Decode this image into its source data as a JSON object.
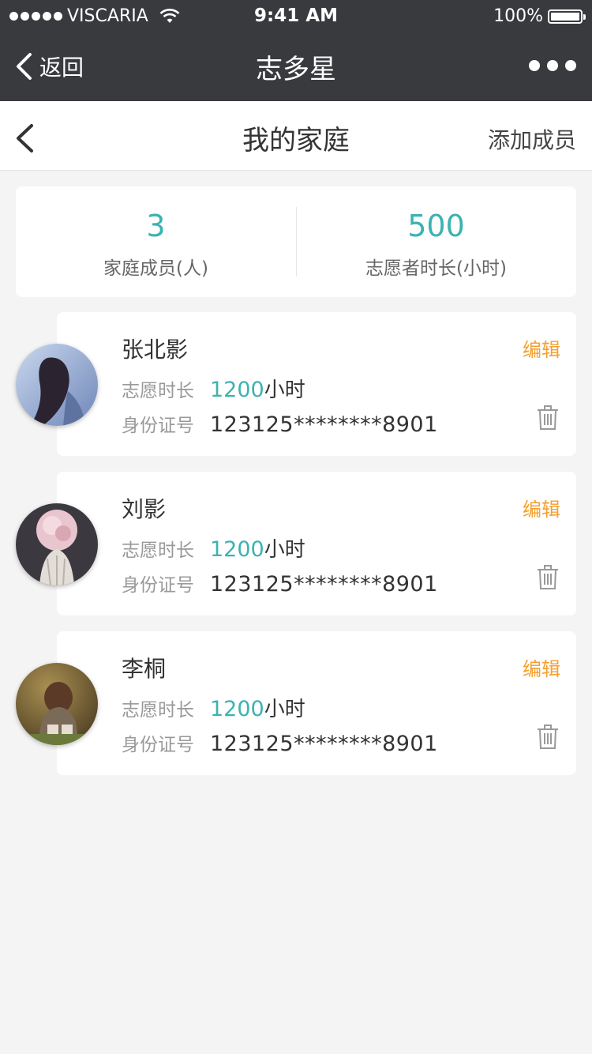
{
  "status_bar": {
    "carrier": "VISCARIA",
    "time": "9:41 AM",
    "battery": "100%"
  },
  "nav": {
    "back_label": "返回",
    "title": "志多星"
  },
  "header": {
    "title": "我的家庭",
    "add_member_label": "添加成员"
  },
  "summary": {
    "members_count": "3",
    "members_label": "家庭成员(人)",
    "hours_value": "500",
    "hours_label": "志愿者时长(小时)"
  },
  "members": [
    {
      "name": "张北影",
      "edit_label": "编辑",
      "hours_label": "志愿时长",
      "hours_value": "1200",
      "hours_unit": "小时",
      "id_label": "身份证号",
      "id_value": "123125********8901"
    },
    {
      "name": "刘影",
      "edit_label": "编辑",
      "hours_label": "志愿时长",
      "hours_value": "1200",
      "hours_unit": "小时",
      "id_label": "身份证号",
      "id_value": "123125********8901"
    },
    {
      "name": "李桐",
      "edit_label": "编辑",
      "hours_label": "志愿时长",
      "hours_value": "1200",
      "hours_unit": "小时",
      "id_label": "身份证号",
      "id_value": "123125********8901"
    }
  ],
  "colors": {
    "accent": "#3bb3b0",
    "edit": "#f5a030",
    "topbar": "#393a3e"
  },
  "icons": {
    "back": "chevron-left-icon",
    "more": "more-dots-icon",
    "delete": "trash-icon",
    "wifi": "wifi-icon",
    "battery": "battery-icon"
  }
}
